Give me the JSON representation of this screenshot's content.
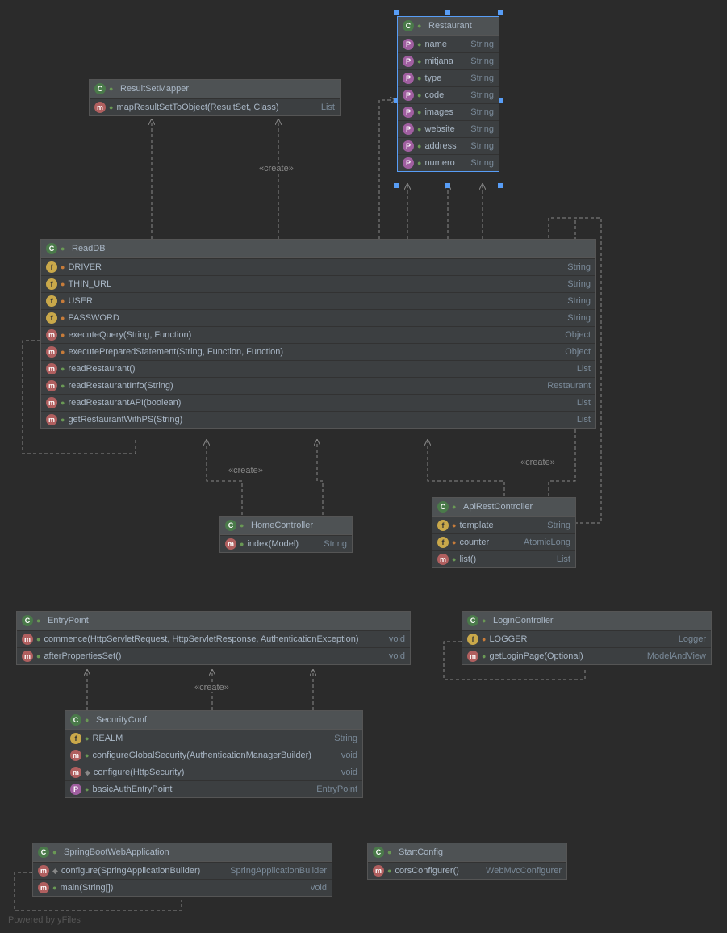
{
  "footer": "Powered by yFiles",
  "createLabel": "«create»",
  "classes": {
    "ResultSetMapper": {
      "name": "ResultSetMapper",
      "members": [
        {
          "k": "m",
          "vis": "pub",
          "name": "mapResultSetToObject(ResultSet, Class)",
          "type": "List<T>"
        }
      ]
    },
    "Restaurant": {
      "name": "Restaurant",
      "members": [
        {
          "k": "p",
          "vis": "pub",
          "name": "name",
          "type": "String"
        },
        {
          "k": "p",
          "vis": "pub",
          "name": "mitjana",
          "type": "String"
        },
        {
          "k": "p",
          "vis": "pub",
          "name": "type",
          "type": "String"
        },
        {
          "k": "p",
          "vis": "pub",
          "name": "code",
          "type": "String"
        },
        {
          "k": "p",
          "vis": "pub",
          "name": "images",
          "type": "String"
        },
        {
          "k": "p",
          "vis": "pub",
          "name": "website",
          "type": "String"
        },
        {
          "k": "p",
          "vis": "pub",
          "name": "address",
          "type": "String"
        },
        {
          "k": "p",
          "vis": "pub",
          "name": "numero",
          "type": "String"
        }
      ]
    },
    "ReadDB": {
      "name": "ReadDB",
      "members": [
        {
          "k": "f",
          "vis": "priv",
          "name": "DRIVER",
          "type": "String"
        },
        {
          "k": "f",
          "vis": "priv",
          "name": "THIN_URL",
          "type": "String"
        },
        {
          "k": "f",
          "vis": "priv",
          "name": "USER",
          "type": "String"
        },
        {
          "k": "f",
          "vis": "priv",
          "name": "PASSWORD",
          "type": "String"
        },
        {
          "k": "m",
          "vis": "priv",
          "name": "executeQuery(String, Function<ResultSet, Object>)",
          "type": "Object"
        },
        {
          "k": "m",
          "vis": "priv",
          "name": "executePreparedStatement(String, Function<PreparedStatement, PreparedStatement>, Function<ResultSet, Object>)",
          "type": "Object"
        },
        {
          "k": "m",
          "vis": "pub",
          "name": "readRestaurant()",
          "type": "List<Restaurant>"
        },
        {
          "k": "m",
          "vis": "pub",
          "name": "readRestaurantInfo(String)",
          "type": "Restaurant"
        },
        {
          "k": "m",
          "vis": "pub",
          "name": "readRestaurantAPI(boolean)",
          "type": "List"
        },
        {
          "k": "m",
          "vis": "pub",
          "name": "getRestaurantWithPS(String)",
          "type": "List<Restaurant>"
        }
      ]
    },
    "HomeController": {
      "name": "HomeController",
      "members": [
        {
          "k": "m",
          "vis": "pub",
          "name": "index(Model)",
          "type": "String"
        }
      ]
    },
    "ApiRestController": {
      "name": "ApiRestController",
      "members": [
        {
          "k": "f",
          "vis": "priv",
          "name": "template",
          "type": "String"
        },
        {
          "k": "f",
          "vis": "priv",
          "name": "counter",
          "type": "AtomicLong"
        },
        {
          "k": "m",
          "vis": "pub",
          "name": "list()",
          "type": "List<Restaurant>"
        }
      ]
    },
    "EntryPoint": {
      "name": "EntryPoint",
      "members": [
        {
          "k": "m",
          "vis": "pub",
          "name": "commence(HttpServletRequest, HttpServletResponse, AuthenticationException)",
          "type": "void"
        },
        {
          "k": "m",
          "vis": "pub",
          "name": "afterPropertiesSet()",
          "type": "void"
        }
      ]
    },
    "LoginController": {
      "name": "LoginController",
      "members": [
        {
          "k": "f",
          "vis": "priv",
          "name": "LOGGER",
          "type": "Logger"
        },
        {
          "k": "m",
          "vis": "pub",
          "name": "getLoginPage(Optional<String>)",
          "type": "ModelAndView"
        }
      ]
    },
    "SecurityConf": {
      "name": "SecurityConf",
      "members": [
        {
          "k": "f",
          "vis": "pub",
          "name": "REALM",
          "type": "String"
        },
        {
          "k": "m",
          "vis": "pub",
          "name": "configureGlobalSecurity(AuthenticationManagerBuilder)",
          "type": "void"
        },
        {
          "k": "m",
          "vis": "prot",
          "name": "configure(HttpSecurity)",
          "type": "void"
        },
        {
          "k": "p",
          "vis": "pub",
          "name": "basicAuthEntryPoint",
          "type": "EntryPoint"
        }
      ]
    },
    "SpringBootWebApplication": {
      "name": "SpringBootWebApplication",
      "members": [
        {
          "k": "m",
          "vis": "prot",
          "name": "configure(SpringApplicationBuilder)",
          "type": "SpringApplicationBuilder"
        },
        {
          "k": "m",
          "vis": "pub",
          "name": "main(String[])",
          "type": "void"
        }
      ]
    },
    "StartConfig": {
      "name": "StartConfig",
      "members": [
        {
          "k": "m",
          "vis": "pub",
          "name": "corsConfigurer()",
          "type": "WebMvcConfigurer"
        }
      ]
    }
  }
}
